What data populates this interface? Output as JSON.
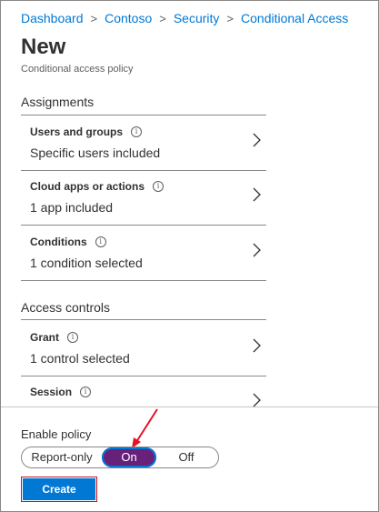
{
  "breadcrumb": [
    "Dashboard",
    "Contoso",
    "Security",
    "Conditional Access"
  ],
  "page": {
    "title": "New",
    "subtitle": "Conditional access policy"
  },
  "assignments": {
    "label": "Assignments",
    "rows": [
      {
        "title": "Users and groups",
        "value": "Specific users included"
      },
      {
        "title": "Cloud apps or actions",
        "value": "1 app included"
      },
      {
        "title": "Conditions",
        "value": "1 condition selected"
      }
    ]
  },
  "access_controls": {
    "label": "Access controls",
    "rows": [
      {
        "title": "Grant",
        "value": "1 control selected"
      },
      {
        "title": "Session",
        "value": ""
      }
    ]
  },
  "enable_policy": {
    "label": "Enable policy",
    "options": [
      "Report-only",
      "On",
      "Off"
    ],
    "selected": "On"
  },
  "create_button": "Create",
  "icons": {
    "info": "info-icon",
    "chevron": "chevron-right-icon",
    "annotation": "red-arrow-annotation"
  },
  "colors": {
    "link": "#0078d4",
    "toggle_selected": "#68217a",
    "primary_button": "#0078d4",
    "annotation": "#e81123"
  }
}
